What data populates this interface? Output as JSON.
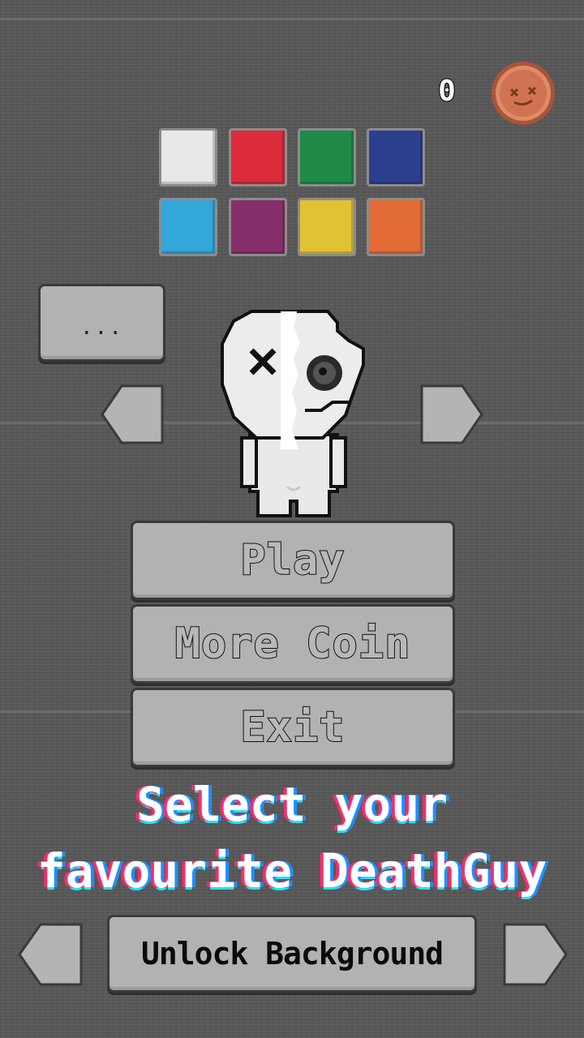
{
  "hud": {
    "coin_count": "0"
  },
  "swatches": [
    {
      "name": "white-swatch",
      "color": "#e8e8e8"
    },
    {
      "name": "red-swatch",
      "color": "#dc2b3b"
    },
    {
      "name": "green-swatch",
      "color": "#1f8a48"
    },
    {
      "name": "blue-swatch",
      "color": "#2c3f8e"
    },
    {
      "name": "cyan-swatch",
      "color": "#33a6da"
    },
    {
      "name": "purple-swatch",
      "color": "#862f6a"
    },
    {
      "name": "yellow-swatch",
      "color": "#e1c233"
    },
    {
      "name": "orange-swatch",
      "color": "#e36b36"
    }
  ],
  "dots_button": {
    "label": "..."
  },
  "menu": {
    "play": "Play",
    "more_coin": "More Coin",
    "exit": "Exit"
  },
  "select_text": {
    "line1": "Select your",
    "line2": "favourite DeathGuy"
  },
  "unlock_button": {
    "label": "Unlock Background"
  },
  "icons": {
    "coin": "coin-icon",
    "character": "deathguy-character",
    "left_arrow": "arrow-left-icon",
    "right_arrow": "arrow-right-icon"
  }
}
